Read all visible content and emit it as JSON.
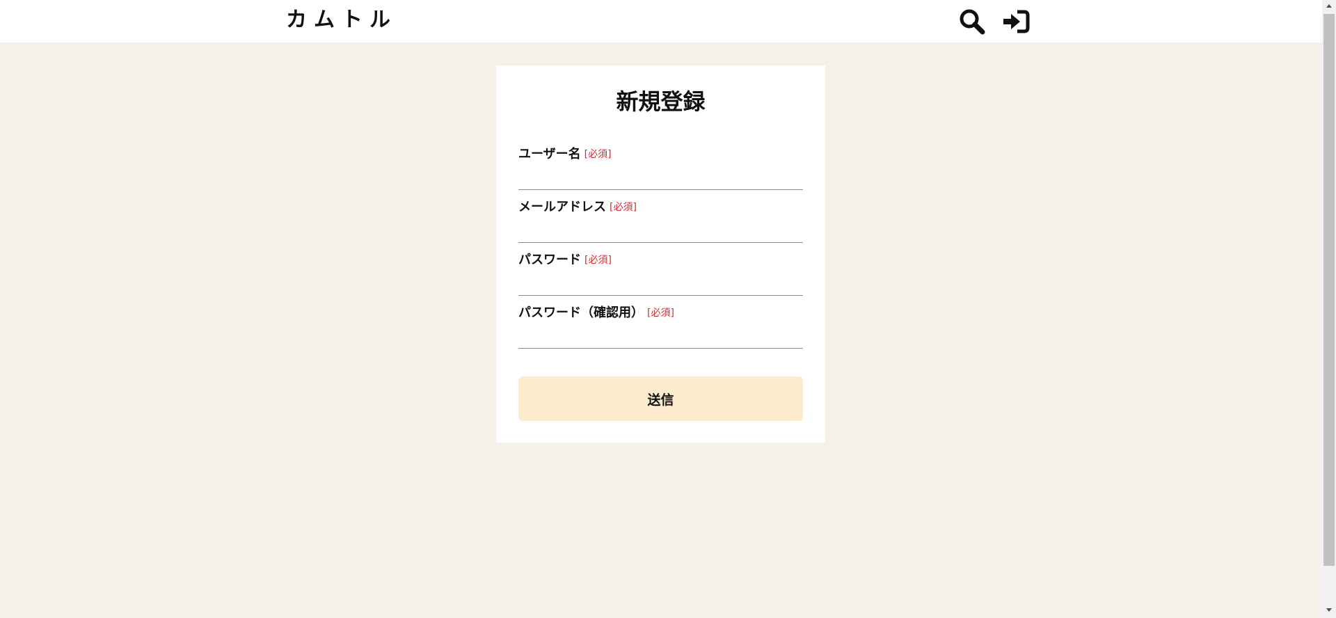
{
  "header": {
    "logo": "カムトル",
    "search_icon": "search-icon",
    "login_icon": "sign-in-icon"
  },
  "form": {
    "title": "新規登録",
    "required_mark": "[必須]",
    "fields": [
      {
        "label": "ユーザー名",
        "value": ""
      },
      {
        "label": "メールアドレス",
        "value": ""
      },
      {
        "label": "パスワード",
        "value": ""
      },
      {
        "label": "パスワード（確認用）",
        "value": ""
      }
    ],
    "submit_label": "送信"
  },
  "colors": {
    "page_background": "#f5f0e8",
    "card_background": "#ffffff",
    "required": "#e0242a",
    "submit_background": "#fdebcd"
  }
}
